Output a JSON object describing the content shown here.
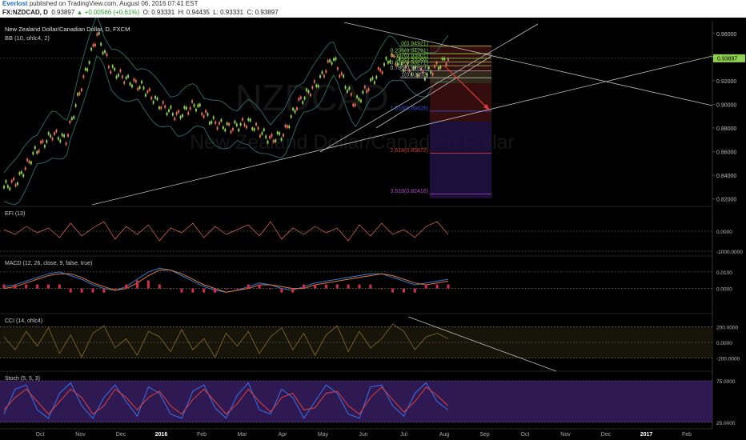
{
  "header": {
    "user": "Everlost",
    "published": "published on TradingView.com, August 06, 2016 07:41 EST"
  },
  "symbol_bar": {
    "symbol": "FX:NZDCAD, D",
    "last": "0.93897",
    "change": "▲ +0.00566 (+0.61%)",
    "open": "O: 0.93331",
    "high": "H: 0.94435",
    "low": "L: 0.93331",
    "close": "C: 0.93897"
  },
  "chart_data": [
    {
      "type": "candlestick",
      "title": "New Zealand Dollar/Canadian Dollar, D, FXCM",
      "indicator": "BB (10, ohlc4, 2)",
      "watermark": [
        "NZDCAD",
        "New Zealand Dollar/Canadian Dollar"
      ],
      "x_ticks": [
        "Oct",
        "Nov",
        "Dec",
        "2016",
        "Feb",
        "Mar",
        "Apr",
        "May",
        "Jun",
        "Jul",
        "Aug",
        "Sep",
        "Oct",
        "Nov",
        "Dec",
        "2017",
        "Feb"
      ],
      "y_ticks": [
        "0.96000",
        "0.94000",
        "0.92000",
        "0.90000",
        "0.88000",
        "0.86000",
        "0.84000",
        "0.82000"
      ],
      "ylim": [
        0.815,
        0.968
      ],
      "last_price": "0.93897",
      "last_price_value": 0.93897,
      "price_path": [
        [
          0,
          0.83
        ],
        [
          0.03,
          0.835
        ],
        [
          0.07,
          0.86
        ],
        [
          0.11,
          0.875
        ],
        [
          0.14,
          0.87
        ],
        [
          0.17,
          0.91
        ],
        [
          0.21,
          0.96
        ],
        [
          0.24,
          0.93
        ],
        [
          0.28,
          0.92
        ],
        [
          0.31,
          0.915
        ],
        [
          0.35,
          0.9
        ],
        [
          0.39,
          0.89
        ],
        [
          0.43,
          0.9
        ],
        [
          0.47,
          0.885
        ],
        [
          0.51,
          0.88
        ],
        [
          0.55,
          0.885
        ],
        [
          0.6,
          0.87
        ],
        [
          0.63,
          0.875
        ],
        [
          0.66,
          0.9
        ],
        [
          0.71,
          0.92
        ],
        [
          0.74,
          0.94
        ],
        [
          0.79,
          0.9
        ],
        [
          0.83,
          0.92
        ],
        [
          0.87,
          0.94
        ],
        [
          0.91,
          0.93
        ],
        [
          0.95,
          0.925
        ],
        [
          1,
          0.939
        ]
      ],
      "fibonacci": [
        {
          "label": "0(0.94921)",
          "value": 0.94921
        },
        {
          "label": "0.236(0.94291)",
          "value": 0.94291
        },
        {
          "label": "0.382(0.93901)",
          "value": 0.93901
        },
        {
          "label": "0.5(0.93586)",
          "value": 0.93586
        },
        {
          "label": "0.618(0.93271)",
          "value": 0.93271
        },
        {
          "label": "0.786(0.92823)",
          "value": 0.92823
        },
        {
          "label": "1(0.92252)",
          "value": 0.92252
        },
        {
          "label": "1.618(0.89428)",
          "value": 0.89428
        },
        {
          "label": "2.618(0.85872)",
          "value": 0.85872
        },
        {
          "label": "3.618(0.82416)",
          "value": 0.82416
        }
      ]
    },
    {
      "type": "line",
      "title": "EFI (13)",
      "y_ticks": [
        "0.0000",
        "-1000.0000"
      ],
      "values": [
        0.1,
        -0.2,
        0.3,
        -0.1,
        0.2,
        -0.4,
        0.5,
        -0.3,
        0.2,
        0.6,
        -0.5,
        0.3,
        -0.2,
        0.4,
        -0.6,
        0.2,
        -0.1,
        0.5,
        -0.4,
        0.3,
        -0.2,
        0.1,
        0.4,
        -0.3,
        0.6,
        -0.5,
        0.2,
        -0.2,
        0.3,
        -0.1,
        0.2,
        -0.6,
        0.4,
        -0.3,
        0.5,
        -0.2,
        0.1,
        -0.4,
        0.3,
        0.6,
        -0.2
      ]
    },
    {
      "type": "line",
      "title": "MACD (12, 26, close, 9, false, true)",
      "y_ticks": [
        "0.0100",
        "0.0000"
      ],
      "macd": [
        -0.1,
        0.0,
        0.2,
        0.4,
        0.6,
        0.7,
        0.5,
        0.3,
        0.0,
        -0.2,
        -0.3,
        -0.1,
        0.3,
        0.7,
        0.9,
        0.8,
        0.5,
        0.2,
        -0.1,
        -0.3,
        -0.4,
        -0.3,
        -0.1,
        0.1,
        0.0,
        -0.2,
        -0.3,
        -0.1,
        0.1,
        0.2,
        0.3,
        0.4,
        0.5,
        0.6,
        0.6,
        0.4,
        0.2,
        0.0,
        0.1,
        0.2,
        0.3
      ],
      "signal": [
        -0.2,
        -0.1,
        0.1,
        0.3,
        0.5,
        0.6,
        0.6,
        0.4,
        0.1,
        -0.1,
        -0.3,
        -0.2,
        0.1,
        0.5,
        0.8,
        0.8,
        0.6,
        0.3,
        0.0,
        -0.2,
        -0.4,
        -0.3,
        -0.2,
        0.0,
        0.0,
        -0.1,
        -0.2,
        -0.2,
        0.0,
        0.1,
        0.2,
        0.3,
        0.4,
        0.5,
        0.6,
        0.5,
        0.3,
        0.1,
        0.0,
        0.1,
        0.2
      ]
    },
    {
      "type": "line",
      "title": "CCI (14, ohlc4)",
      "y_ticks": [
        "200.0000",
        "0.0000",
        "-200.0000"
      ],
      "values": [
        0.3,
        -0.4,
        0.6,
        -0.2,
        0.8,
        -0.6,
        0.4,
        -0.8,
        0.5,
        0.9,
        -0.3,
        0.2,
        -0.7,
        0.6,
        0.3,
        -0.5,
        0.7,
        -0.4,
        0.2,
        -0.8,
        0.5,
        -0.2,
        0.6,
        -0.6,
        0.3,
        0.8,
        -0.4,
        0.5,
        -0.7,
        0.4,
        0.9,
        -0.5,
        0.6,
        -0.3,
        0.2,
        1.0,
        0.6,
        -0.4,
        0.3,
        0.5,
        0.2
      ]
    },
    {
      "type": "line",
      "title": "Stoch (5, 5, 3)",
      "y_ticks": [
        "75.0000",
        "25.0000"
      ],
      "k": [
        0.2,
        0.8,
        0.9,
        0.3,
        0.1,
        0.7,
        0.95,
        0.4,
        0.1,
        0.6,
        0.9,
        0.5,
        0.15,
        0.85,
        0.7,
        0.2,
        0.1,
        0.75,
        0.9,
        0.35,
        0.1,
        0.65,
        0.95,
        0.3,
        0.2,
        0.8,
        0.6,
        0.1,
        0.5,
        0.9,
        0.7,
        0.2,
        0.1,
        0.85,
        0.9,
        0.4,
        0.15,
        0.7,
        0.95,
        0.5,
        0.3
      ],
      "d": [
        0.3,
        0.6,
        0.8,
        0.5,
        0.2,
        0.5,
        0.8,
        0.6,
        0.2,
        0.4,
        0.8,
        0.6,
        0.3,
        0.6,
        0.75,
        0.4,
        0.2,
        0.55,
        0.8,
        0.5,
        0.2,
        0.45,
        0.8,
        0.5,
        0.25,
        0.6,
        0.7,
        0.3,
        0.35,
        0.7,
        0.75,
        0.4,
        0.2,
        0.6,
        0.85,
        0.55,
        0.25,
        0.5,
        0.85,
        0.65,
        0.4
      ]
    }
  ],
  "colors": {
    "background": "#000000",
    "candle_up": "#8fd14f",
    "candle_down": "#e86a5a",
    "bollinger": "#2f6f68",
    "trendline": "#bdbdbd",
    "fib_red": "#d23b3b",
    "fib_blue": "#3f4fd8",
    "fib_purple": "#b04cc4",
    "stoch_band": "#3a1f66",
    "macd_line": "#2e7ad1",
    "signal_line": "#e07b39",
    "histogram": "#d62c4c",
    "cci_line": "#8a6d2b",
    "stoch_k": "#3a72e8",
    "stoch_d": "#e0403a"
  }
}
